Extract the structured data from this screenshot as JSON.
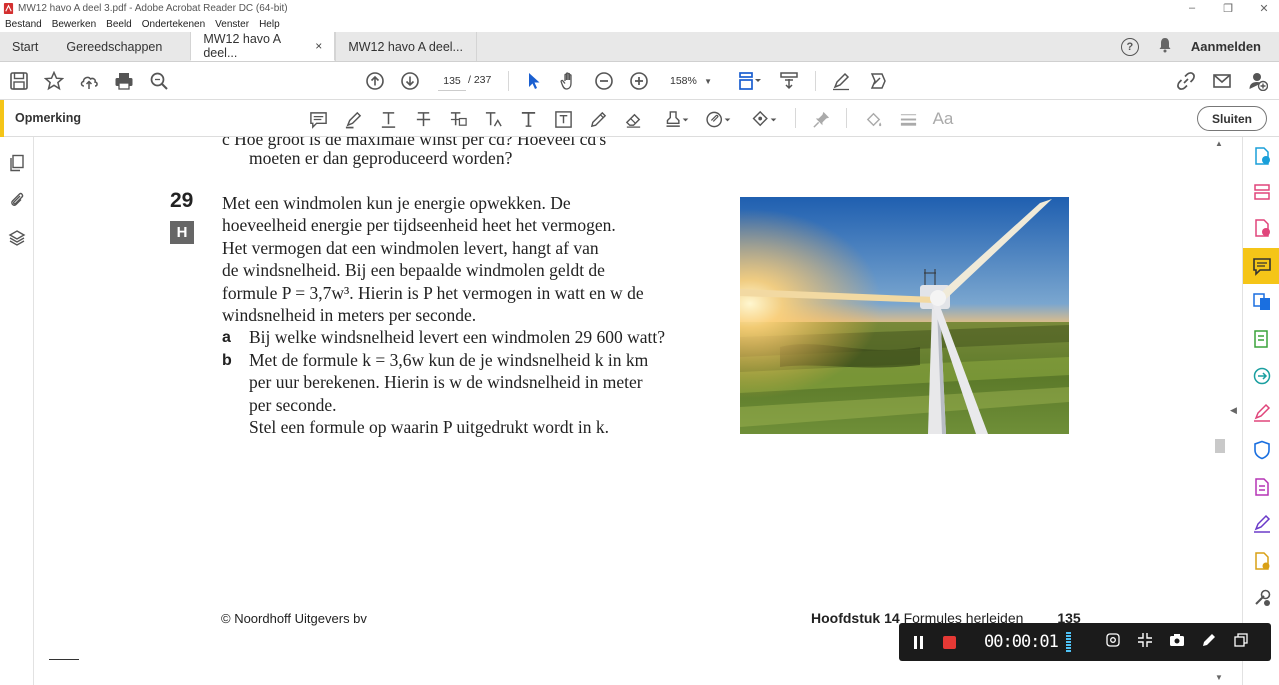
{
  "window": {
    "title": "MW12 havo A deel 3.pdf - Adobe Acrobat Reader DC (64-bit)",
    "controls": [
      "–",
      "❐",
      "✕"
    ]
  },
  "menu": [
    "Bestand",
    "Bewerken",
    "Beeld",
    "Ondertekenen",
    "Venster",
    "Help"
  ],
  "tabs": {
    "start": "Start",
    "tools": "Gereedschappen",
    "doc1": "MW12 havo A deel...",
    "doc2": "MW12 havo A deel...",
    "close": "×"
  },
  "account": {
    "signin": "Aanmelden",
    "help": "?"
  },
  "toolbar": {
    "page_current": "135",
    "page_total": "/ 237",
    "zoom": "158%"
  },
  "comment_toolbar": {
    "label": "Opmerking",
    "close_label": "Sluiten"
  },
  "document": {
    "cut_line_1": "c   Hoe groot is de maximale winst per cd? Hoeveel cd's",
    "cut_line_2": "moeten er dan geproduceerd worden?",
    "exercise_number": "29",
    "level_badge": "H",
    "intro_lines": [
      "Met een windmolen kun je energie opwekken. De",
      "hoeveelheid energie per tijdseenheid heet het vermogen.",
      "Het vermogen dat een windmolen levert, hangt af van",
      "de windsnelheid. Bij een bepaalde windmolen geldt de",
      "formule P = 3,7w³. Hierin is P het vermogen in watt en w de",
      "windsnelheid in meters per seconde."
    ],
    "item_a_letter": "a",
    "item_a": "Bij welke windsnelheid levert een windmolen 29 600 watt?",
    "item_b_letter": "b",
    "item_b_lines": [
      "Met de formule k = 3,6w kun de je windsnelheid k in km",
      "per uur berekenen. Hierin is w de windsnelheid in meter",
      "per seconde.",
      "Stel een formule op waarin P uitgedrukt wordt in k."
    ],
    "footer_left": "© Noordhoff Uitgevers bv",
    "footer_chapter": "Hoofdstuk 14",
    "footer_title": " Formules herleiden",
    "footer_page": "135"
  },
  "recorder": {
    "time": "00:00:01"
  },
  "colors": {
    "accent": "#f5c518",
    "text": "#222222",
    "recorder_bg": "#1b1b1b"
  }
}
